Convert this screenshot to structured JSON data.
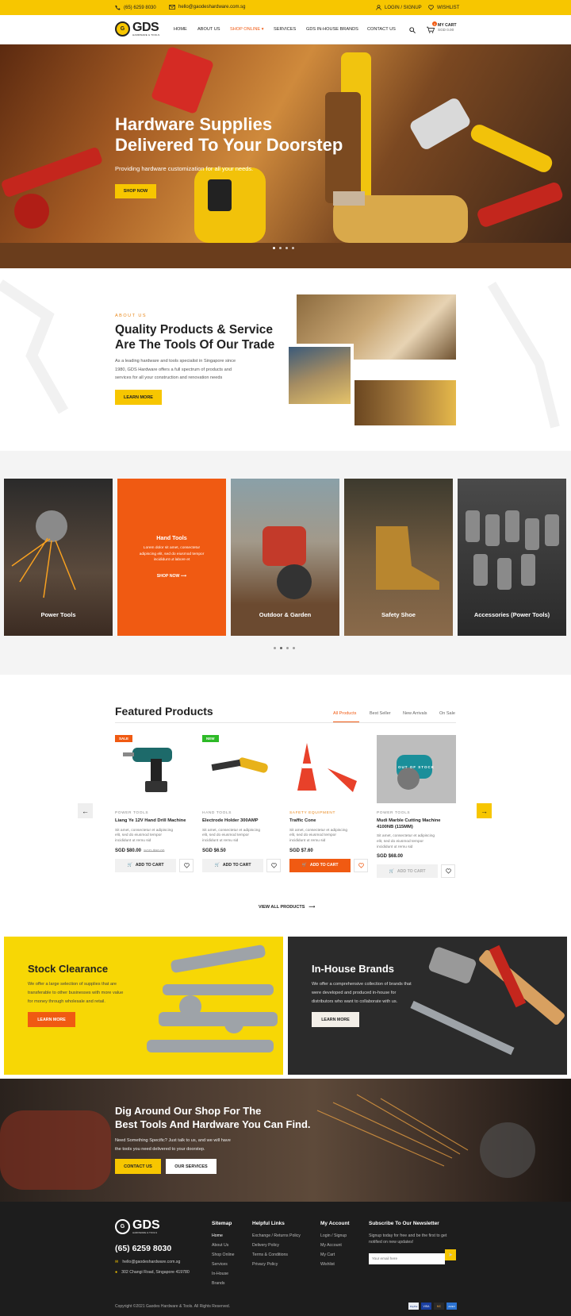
{
  "topbar": {
    "phone": "(65) 6259 8030",
    "email": "hello@gaodeshardware.com.sg",
    "login": "LOGIN / SIGNUP",
    "wishlist": "WISHLIST"
  },
  "brand": {
    "name": "GDS",
    "tagline": "HARDWARE & TOOLS",
    "accent": "#f7c600",
    "orange": "#f05a12"
  },
  "nav": {
    "items": [
      "HOME",
      "ABOUT US",
      "SHOP ONLINE",
      "SERVICES",
      "GDS IN-HOUSE BRANDS",
      "CONTACT US"
    ],
    "cart_label": "MY CART",
    "cart_total": "SGD 0.00",
    "cart_count": "0"
  },
  "hero": {
    "title_line1": "Hardware Supplies",
    "title_line2": "Delivered To Your Doorstep",
    "subtitle": "Providing hardware customization for all your needs.",
    "cta": "SHOP NOW"
  },
  "about": {
    "eyebrow": "ABOUT US",
    "title_line1": "Quality Products & Service",
    "title_line2": "Are The Tools Of Our Trade",
    "text_l1": "As a leading hardware and tools specialist in Singapore since",
    "text_l2": "1980, GDS Hardware offers a full spectrum of products and",
    "text_l3": "services for all your construction and renovation needs",
    "cta": "LEARN MORE"
  },
  "categories": {
    "items": [
      {
        "label": "Power Tools"
      },
      {
        "label": "Hand Tools",
        "text_l1": "Lorem dolor sit amet, consectetur",
        "text_l2": "adipiscing elit, sed do eiusmod tempor",
        "text_l3": "incididunt ut labore et",
        "cta": "SHOP NOW"
      },
      {
        "label": "Outdoor & Garden"
      },
      {
        "label": "Safety Shoe"
      },
      {
        "label": "Accessories (Power Tools)"
      }
    ]
  },
  "featured": {
    "title": "Featured Products",
    "tabs": [
      "All Products",
      "Best Seller",
      "New Arrivals",
      "On Sale"
    ],
    "products": [
      {
        "tag": "SALE",
        "category": "POWER TOOLS",
        "name": "Liang Ye 12V Hand Drill Machine",
        "desc_l1": "Sit amet, consectetur et adipiscing",
        "desc_l2": "elit, sed do eiusmod tempor",
        "desc_l3": "incididunt ut remu sid",
        "price": "SGD $80.00",
        "old_price": "SGD $90.00",
        "cart": "ADD TO CART"
      },
      {
        "tag": "NEW",
        "category": "HAND TOOLS",
        "name": "Electrode Holder 300AMP",
        "desc_l1": "Sit amet, consectetur et adipiscing",
        "desc_l2": "elit, sed do eiusmod tempor",
        "desc_l3": "incididunt ut remu sid",
        "price": "SGD $6.50",
        "cart": "ADD TO CART"
      },
      {
        "category": "SAFETY EQUIPMENT",
        "name": "Traffic Cone",
        "desc_l1": "Sit amet, consectetur et adipiscing",
        "desc_l2": "elit, sed do eiusmod tempor",
        "desc_l3": "incididunt ut remu sid",
        "price": "SGD $7.60",
        "cart": "ADD TO CART"
      },
      {
        "overlay": "OUT OF STOCK",
        "category": "POWER TOOLS",
        "name_l1": "Mudi Marble Cutting Machine",
        "name_l2": "4100NB (115MM)",
        "desc_l1": "Sit amet, consectetur et adipiscing",
        "desc_l2": "elit, sed do eiusmod tempor",
        "desc_l3": "incididunt ut remu sid",
        "price": "SGD $68.00",
        "cart": "ADD TO CART"
      }
    ],
    "view_all": "VIEW ALL PRODUCTS"
  },
  "promos": [
    {
      "title": "Stock Clearance",
      "text_l1": "We offer a large selection of supplies that are",
      "text_l2": "transferable to other businesses with more value",
      "text_l3": "for money through wholesale and retail.",
      "cta": "LEARN MORE"
    },
    {
      "title": "In-House Brands",
      "text_l1": "We offer a comprehensive collection of brands that",
      "text_l2": "were developed and produced in-house for",
      "text_l3": "distributors who want to collaborate with us.",
      "cta": "LEARN MORE"
    }
  ],
  "cta": {
    "title_line1": "Dig Around Our Shop For The",
    "title_line2": "Best Tools And Hardware You Can Find.",
    "text_l1": "Need Something Specific? Just talk to us, and we will have",
    "text_l2": "the tools you need delivered to your doorstep.",
    "btn1": "CONTACT US",
    "btn2": "OUR SERVICES"
  },
  "footer": {
    "phone": "(65) 6259 8030",
    "email": "hello@gaodeshardware.com.sg",
    "address": "302 Changi Road, Singapore 419780",
    "sitemap_title": "Sitemap",
    "sitemap": [
      "Home",
      "About Us",
      "Shop Online",
      "Services",
      "In-House",
      "Brands"
    ],
    "helpful_title": "Helpful Links",
    "helpful": [
      "Exchange / Returns Policy",
      "Delivery Policy",
      "Terms & Conditions",
      "Privacy Policy"
    ],
    "account_title": "My Account",
    "account": [
      "Login / Signup",
      "My Account",
      "My Cart",
      "Wishlist"
    ],
    "newsletter_title": "Subscribe To Our Newsletter",
    "newsletter_l1": "Signup today for free and be the first to get",
    "newsletter_l2": "notified on new updates!",
    "newsletter_placeholder": "Your email here",
    "copyright": "Copyright ©2021 Gaodes Hardware & Tools. All Rights Reserved.",
    "payments": [
      "PayPal",
      "VISA",
      "MC",
      "AMEX"
    ]
  }
}
